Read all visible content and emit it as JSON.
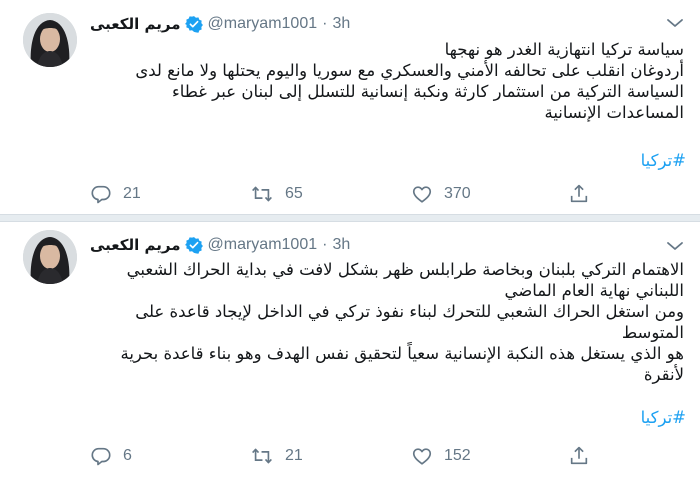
{
  "tweets": [
    {
      "display_name": "مريم الكعبى",
      "handle": "@maryam1001",
      "separator": "·",
      "time": "3h",
      "body_lines": [
        "سياسة تركيا انتهازية الغدر هو نهجها",
        "أردوغان انقلب على تحالفه الأمني والعسكري مع سوريا واليوم يحتلها ولا مانع لدى",
        "السياسة التركية من استثمار كارثة ونكبة إنسانية للتسلل إلى لبنان عبر غطاء",
        "المساعدات الإنسانية"
      ],
      "hashtag": "#تركيا",
      "reply_count": "21",
      "retweet_count": "65",
      "like_count": "370"
    },
    {
      "display_name": "مريم الكعبى",
      "handle": "@maryam1001",
      "separator": "·",
      "time": "3h",
      "body_lines": [
        "الاهتمام التركي بلبنان وبخاصة طرابلس ظهر بشكل لافت في بداية الحراك الشعبي",
        "اللبناني نهاية العام الماضي",
        "ومن استغل الحراك الشعبي للتحرك لبناء نفوذ تركي في الداخل لإيجاد قاعدة على",
        "المتوسط",
        "هو الذي يستغل هذه النكبة الإنسانية سعياً لتحقيق نفس الهدف وهو بناء قاعدة بحرية",
        "لأنقرة"
      ],
      "hashtag": "#تركيا",
      "reply_count": "6",
      "retweet_count": "21",
      "like_count": "152"
    }
  ],
  "colors": {
    "text": "#14171a",
    "secondary": "#657786",
    "accent": "#1da1f2",
    "separator": "#e6ecf0"
  },
  "icons": {
    "verified": "verified-badge-icon",
    "more": "chevron-down-icon",
    "reply": "reply-icon",
    "retweet": "retweet-icon",
    "like": "heart-icon",
    "share": "share-icon"
  }
}
